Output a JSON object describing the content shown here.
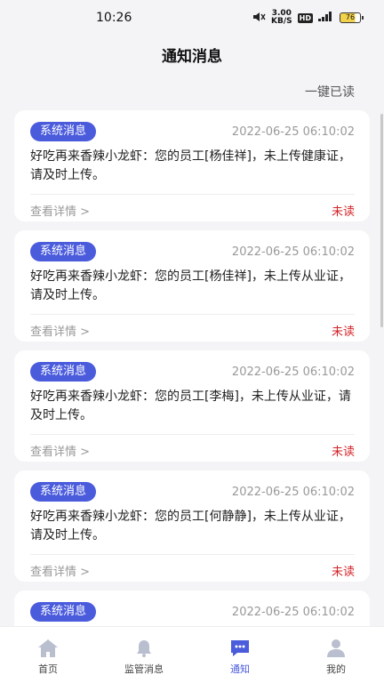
{
  "status": {
    "time": "10:26",
    "speed_value": "3.00",
    "speed_unit": "KB/S",
    "hd": "HD",
    "signal": "⁵ᴳ",
    "battery": "76"
  },
  "header": {
    "title": "通知消息"
  },
  "actions": {
    "mark_all_read": "一键已读"
  },
  "notifications": [
    {
      "badge": "系统消息",
      "time": "2022-06-25 06:10:02",
      "content": "好吃再来香辣小龙虾：您的员工[杨佳祥]，未上传健康证，请及时上传。",
      "detail": "查看详情 >",
      "status": "未读"
    },
    {
      "badge": "系统消息",
      "time": "2022-06-25 06:10:02",
      "content": "好吃再来香辣小龙虾：您的员工[杨佳祥]，未上传从业证，请及时上传。",
      "detail": "查看详情 >",
      "status": "未读"
    },
    {
      "badge": "系统消息",
      "time": "2022-06-25 06:10:02",
      "content": "好吃再来香辣小龙虾：您的员工[李梅]，未上传从业证，请及时上传。",
      "detail": "查看详情 >",
      "status": "未读"
    },
    {
      "badge": "系统消息",
      "time": "2022-06-25 06:10:02",
      "content": "好吃再来香辣小龙虾：您的员工[何静静]，未上传从业证，请及时上传。",
      "detail": "查看详情 >",
      "status": "未读"
    },
    {
      "badge": "系统消息",
      "time": "2022-06-25 06:10:02",
      "content": "",
      "detail": "",
      "status": ""
    }
  ],
  "tabs": [
    {
      "label": "首页",
      "icon": "home-icon"
    },
    {
      "label": "监管消息",
      "icon": "bell-icon"
    },
    {
      "label": "通知",
      "icon": "chat-icon"
    },
    {
      "label": "我的",
      "icon": "user-icon"
    }
  ],
  "colors": {
    "accent": "#4a5bdc",
    "unread": "#d3252a"
  }
}
